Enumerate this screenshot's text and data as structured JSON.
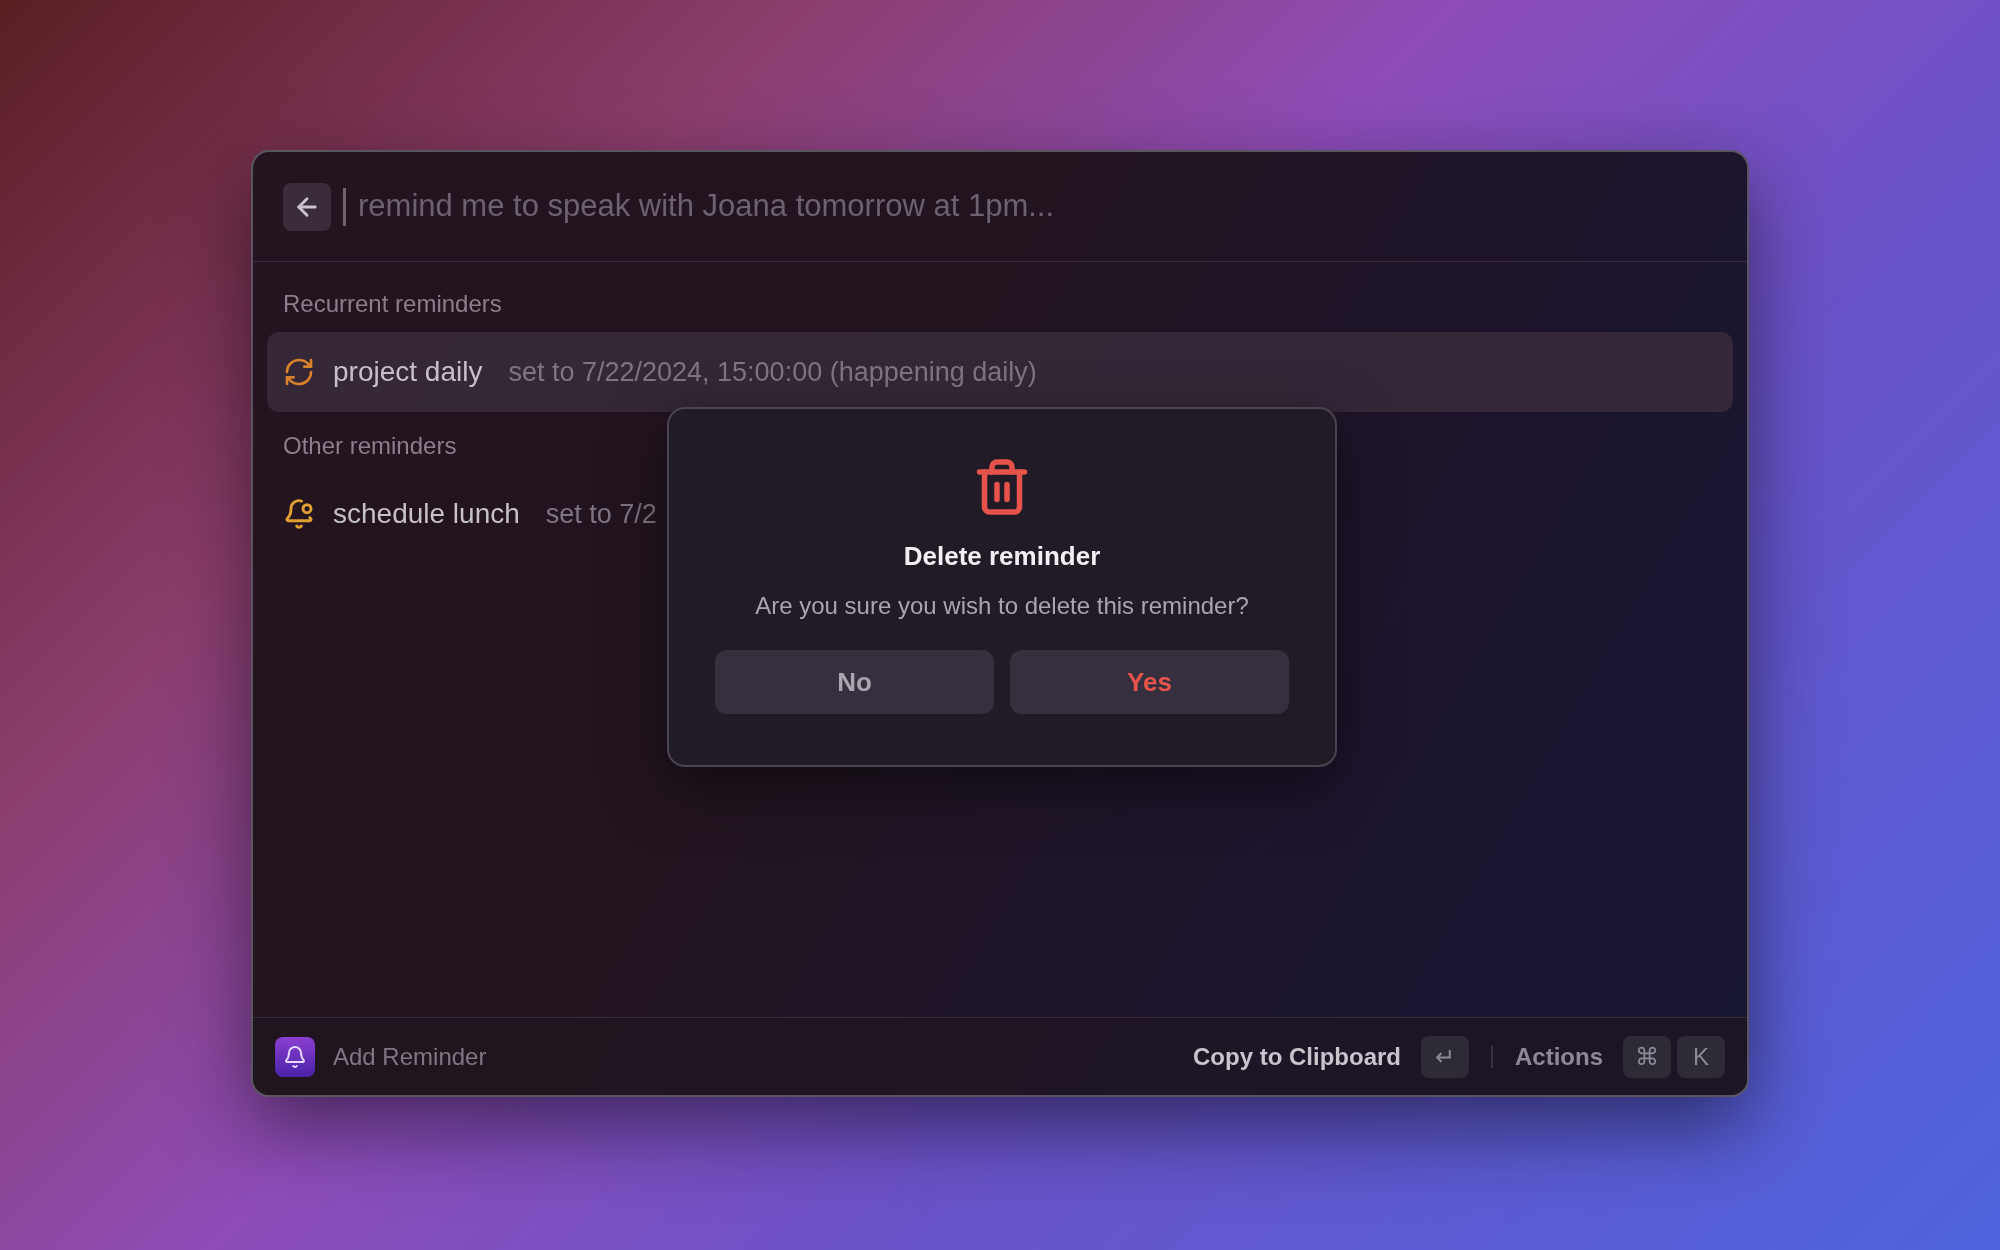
{
  "search": {
    "placeholder": "remind me to speak with Joana tomorrow at 1pm..."
  },
  "sections": [
    {
      "title": "Recurrent reminders",
      "items": [
        {
          "kind": "recurring",
          "title": "project daily",
          "detail": "set to 7/22/2024, 15:00:00 (happening daily)",
          "selected": true
        }
      ]
    },
    {
      "title": "Other reminders",
      "items": [
        {
          "kind": "single",
          "title": "schedule lunch",
          "detail": "set to 7/2",
          "selected": false
        }
      ]
    }
  ],
  "dialog": {
    "title": "Delete reminder",
    "message": "Are you sure you wish to delete this reminder?",
    "buttons": [
      {
        "label": "No",
        "kind": "neutral"
      },
      {
        "label": "Yes",
        "kind": "destructive"
      }
    ]
  },
  "footer": {
    "app_label": "Add Reminder",
    "primary_action": {
      "label": "Copy to Clipboard",
      "keys": [
        "↵"
      ]
    },
    "secondary_action": {
      "label": "Actions",
      "keys": [
        "⌘",
        "K"
      ]
    }
  }
}
